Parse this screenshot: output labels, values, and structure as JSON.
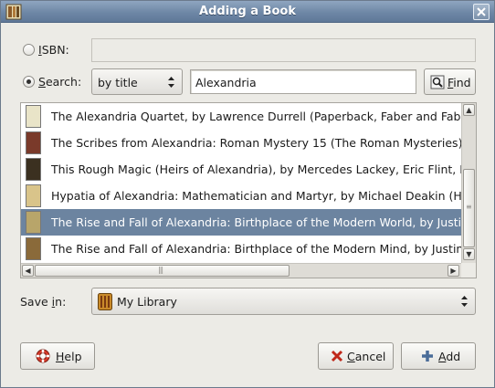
{
  "window": {
    "title": "Adding a Book",
    "app_icon": "book-app-icon",
    "close_icon": "close-icon"
  },
  "isbn": {
    "label_prefix": "I",
    "label_rest": "SBN:",
    "selected": false,
    "value": ""
  },
  "search": {
    "label_prefix": "S",
    "label_rest": "earch:",
    "selected": true,
    "mode": "by title",
    "query": "Alexandria",
    "find_prefix": "F",
    "find_rest": "ind",
    "find_icon": "find-icon"
  },
  "results": [
    {
      "text": "The Alexandria Quartet, by Lawrence Durrell (Paperback, Faber and Faber)",
      "cover": "#e9e4c8",
      "selected": false
    },
    {
      "text": "The Scribes from Alexandria: Roman Mystery 15 (The Roman Mysteries), by",
      "cover": "#7a3a2a",
      "selected": false
    },
    {
      "text": "This Rough Magic (Heirs of Alexandria), by Mercedes Lackey, Eric Flint, Dave",
      "cover": "#3b3020",
      "selected": false
    },
    {
      "text": "Hypatia of Alexandria: Mathematician and Martyr, by Michael Deakin (Hardcove",
      "cover": "#d9c48a",
      "selected": false
    },
    {
      "text": "The Rise and Fall of Alexandria: Birthplace of the Modern World, by Justin Pol",
      "cover": "#b8a56a",
      "selected": true
    },
    {
      "text": "The Rise and Fall of Alexandria: Birthplace of the Modern Mind, by Justin Polla",
      "cover": "#8a6a3a",
      "selected": false
    }
  ],
  "save_in": {
    "label_prefix": "Save ",
    "label_u": "i",
    "label_rest": "n:",
    "value": "My Library",
    "icon": "library-icon"
  },
  "buttons": {
    "help_prefix": "H",
    "help_rest": "elp",
    "help_icon": "lifebuoy-icon",
    "cancel_prefix": "C",
    "cancel_rest": "ancel",
    "cancel_icon": "cancel-x-icon",
    "add_prefix": "A",
    "add_rest": "dd",
    "add_icon": "plus-icon"
  },
  "colors": {
    "selection": "#6c84a0",
    "titlebar": "#6e87a6"
  }
}
